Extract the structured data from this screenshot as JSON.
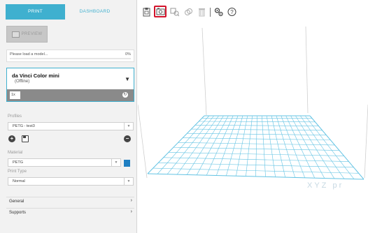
{
  "tabs": {
    "print": "PRINT",
    "dashboard": "DASHBOARD"
  },
  "preview_button": "PREVIEW",
  "status": {
    "text": "Please load a model...",
    "percent": "0%"
  },
  "printer": {
    "name": "da Vinci Color mini",
    "state": "(Offline)",
    "count": "1x"
  },
  "profiles": {
    "label": "Profiles",
    "value": "PETG - test3"
  },
  "material": {
    "label": "Material",
    "value": "PETG"
  },
  "print_type": {
    "label": "Print Type",
    "value": "Normal"
  },
  "sections": {
    "general": "General",
    "supports": "Supports"
  },
  "toolbar": {
    "icons": [
      "clipboard-icon",
      "load-model-icon",
      "transform-icon",
      "duplicate-icon",
      "delete-icon",
      "settings-icon",
      "help-icon"
    ],
    "selected": "load-model-icon"
  },
  "watermark": "XYZ pr",
  "colors": {
    "accent": "#3fb0cf",
    "material_swatch": "#1f7fc2",
    "selection": "#d3132b",
    "grid": "#63c3e3"
  }
}
